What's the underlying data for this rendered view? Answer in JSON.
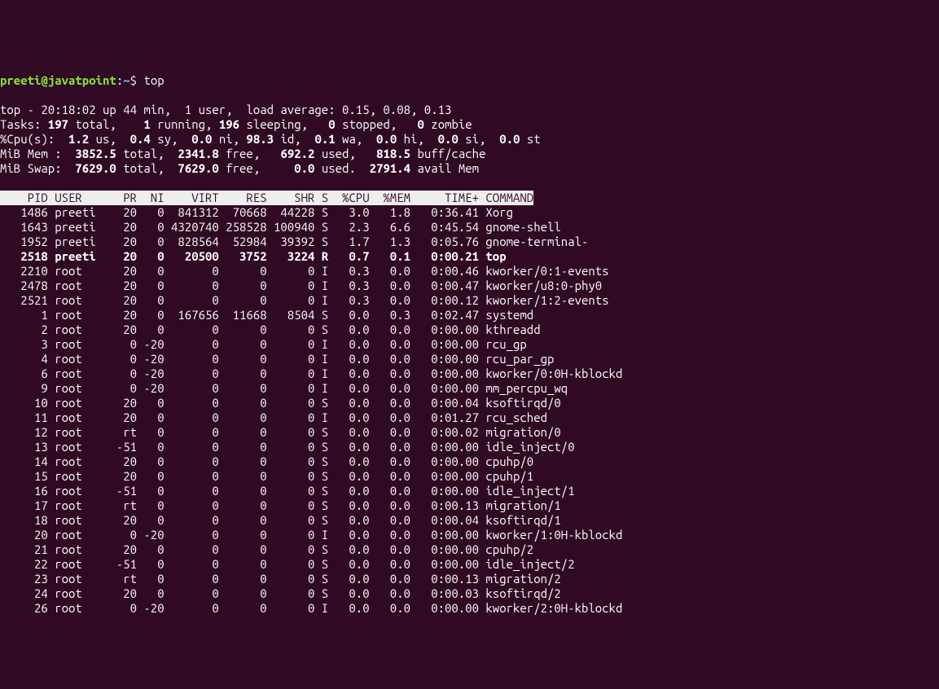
{
  "prompt": {
    "user": "preeti@javatpoint",
    "sep": ":",
    "path": "~",
    "dollar": "$",
    "command": "top"
  },
  "summary": {
    "line1": "top - 20:18:02 up 44 min,  1 user,  load average: 0.15, 0.08, 0.13",
    "tasks_label": "Tasks:",
    "tasks_total": " 197 ",
    "tasks_total_lbl": "total,  ",
    "tasks_running": "  1 ",
    "tasks_running_lbl": "running, ",
    "tasks_sleeping": "196 ",
    "tasks_sleeping_lbl": "sleeping, ",
    "tasks_stopped": "  0 ",
    "tasks_stopped_lbl": "stopped, ",
    "tasks_zombie": "  0 ",
    "tasks_zombie_lbl": "zombie",
    "cpu_label": "%Cpu(s):",
    "cpu_us": "  1.2 ",
    "cpu_us_lbl": "us,",
    "cpu_sy": "  0.4 ",
    "cpu_sy_lbl": "sy,",
    "cpu_ni": "  0.0 ",
    "cpu_ni_lbl": "ni,",
    "cpu_id": " 98.3 ",
    "cpu_id_lbl": "id,",
    "cpu_wa": "  0.1 ",
    "cpu_wa_lbl": "wa,",
    "cpu_hi": "  0.0 ",
    "cpu_hi_lbl": "hi,",
    "cpu_si": "  0.0 ",
    "cpu_si_lbl": "si,",
    "cpu_st": "  0.0 ",
    "cpu_st_lbl": "st",
    "mem_label": "MiB Mem :",
    "mem_total": "  3852.5 ",
    "mem_total_lbl": "total,",
    "mem_free": "  2341.8 ",
    "mem_free_lbl": "free,",
    "mem_used": "   692.2 ",
    "mem_used_lbl": "used,",
    "mem_buff": "   818.5 ",
    "mem_buff_lbl": "buff/cache",
    "swap_label": "MiB Swap:",
    "swap_total": "  7629.0 ",
    "swap_total_lbl": "total,",
    "swap_free": "  7629.0 ",
    "swap_free_lbl": "free,",
    "swap_used": "     0.0 ",
    "swap_used_lbl": "used.",
    "swap_avail": "  2791.4 ",
    "swap_avail_lbl": "avail Mem"
  },
  "headers": "    PID USER      PR  NI    VIRT    RES    SHR S  %CPU  %MEM     TIME+ COMMAND",
  "processes": [
    "   1486 preeti    20   0  841312  70668  44228 S   3.0   1.8   0:36.41 Xorg",
    "   1643 preeti    20   0 4320740 258528 100940 S   2.3   6.6   0:45.54 gnome-shell",
    "   1952 preeti    20   0  828564  52984  39392 S   1.7   1.3   0:05.76 gnome-terminal-",
    "   2518 preeti    20   0   20500   3752   3224 R   0.7   0.1   0:00.21 top",
    "   2210 root      20   0       0      0      0 I   0.3   0.0   0:00.46 kworker/0:1-events",
    "   2478 root      20   0       0      0      0 I   0.3   0.0   0:00.47 kworker/u8:0-phy0",
    "   2521 root      20   0       0      0      0 I   0.3   0.0   0:00.12 kworker/1:2-events",
    "      1 root      20   0  167656  11668   8504 S   0.0   0.3   0:02.47 systemd",
    "      2 root      20   0       0      0      0 S   0.0   0.0   0:00.00 kthreadd",
    "      3 root       0 -20       0      0      0 I   0.0   0.0   0:00.00 rcu_gp",
    "      4 root       0 -20       0      0      0 I   0.0   0.0   0:00.00 rcu_par_gp",
    "      6 root       0 -20       0      0      0 I   0.0   0.0   0:00.00 kworker/0:0H-kblockd",
    "      9 root       0 -20       0      0      0 I   0.0   0.0   0:00.00 mm_percpu_wq",
    "     10 root      20   0       0      0      0 S   0.0   0.0   0:00.04 ksoftirqd/0",
    "     11 root      20   0       0      0      0 I   0.0   0.0   0:01.27 rcu_sched",
    "     12 root      rt   0       0      0      0 S   0.0   0.0   0:00.02 migration/0",
    "     13 root     -51   0       0      0      0 S   0.0   0.0   0:00.00 idle_inject/0",
    "     14 root      20   0       0      0      0 S   0.0   0.0   0:00.00 cpuhp/0",
    "     15 root      20   0       0      0      0 S   0.0   0.0   0:00.00 cpuhp/1",
    "     16 root     -51   0       0      0      0 S   0.0   0.0   0:00.00 idle_inject/1",
    "     17 root      rt   0       0      0      0 S   0.0   0.0   0:00.13 migration/1",
    "     18 root      20   0       0      0      0 S   0.0   0.0   0:00.04 ksoftirqd/1",
    "     20 root       0 -20       0      0      0 I   0.0   0.0   0:00.00 kworker/1:0H-kblockd",
    "     21 root      20   0       0      0      0 S   0.0   0.0   0:00.00 cpuhp/2",
    "     22 root     -51   0       0      0      0 S   0.0   0.0   0:00.00 idle_inject/2",
    "     23 root      rt   0       0      0      0 S   0.0   0.0   0:00.13 migration/2",
    "     24 root      20   0       0      0      0 S   0.0   0.0   0:00.03 ksoftirqd/2",
    "     26 root       0 -20       0      0      0 I   0.0   0.0   0:00.00 kworker/2:0H-kblockd"
  ],
  "highlight_index": 3
}
